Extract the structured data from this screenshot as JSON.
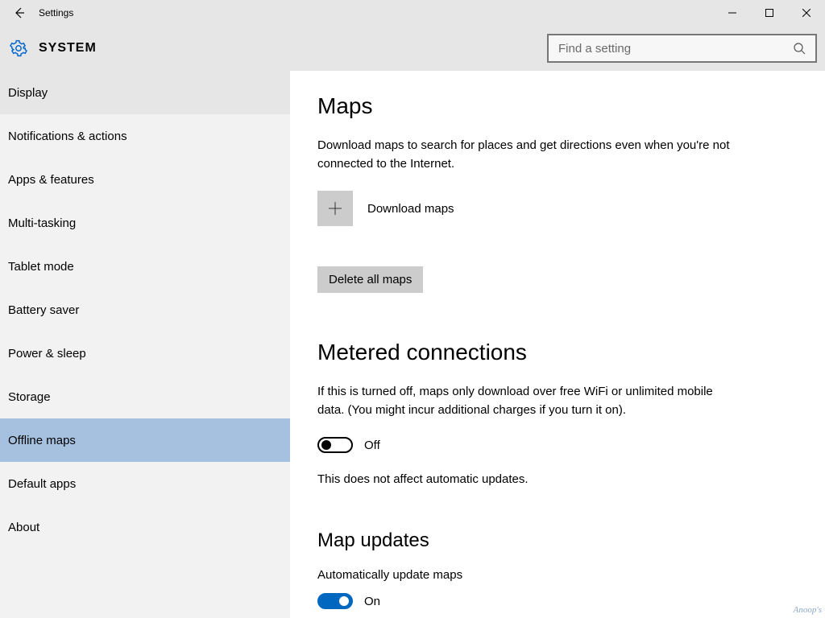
{
  "window": {
    "title": "Settings"
  },
  "header": {
    "title": "SYSTEM"
  },
  "search": {
    "placeholder": "Find a setting"
  },
  "sidebar": {
    "items": [
      {
        "label": "Display"
      },
      {
        "label": "Notifications & actions"
      },
      {
        "label": "Apps & features"
      },
      {
        "label": "Multi-tasking"
      },
      {
        "label": "Tablet mode"
      },
      {
        "label": "Battery saver"
      },
      {
        "label": "Power & sleep"
      },
      {
        "label": "Storage"
      },
      {
        "label": "Offline maps"
      },
      {
        "label": "Default apps"
      },
      {
        "label": "About"
      }
    ]
  },
  "content": {
    "maps": {
      "heading": "Maps",
      "desc": "Download maps to search for places and get directions even when you're not connected to the Internet.",
      "download_label": "Download maps",
      "delete_label": "Delete all maps"
    },
    "metered": {
      "heading": "Metered connections",
      "desc": "If this is turned off, maps only download over free WiFi or unlimited mobile data. (You might incur additional charges if you turn it on).",
      "toggle_state": "Off",
      "note": "This does not affect automatic updates."
    },
    "updates": {
      "heading": "Map updates",
      "auto_label": "Automatically update maps",
      "toggle_state": "On"
    }
  },
  "watermark": "Anoop's"
}
